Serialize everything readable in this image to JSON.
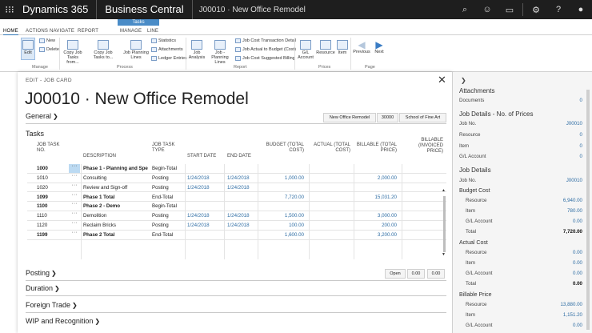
{
  "topbar": {
    "product": "Dynamics 365",
    "app": "Business Central",
    "breadcrumb": "J00010 · New Office Remodel"
  },
  "ribbon": {
    "context_group": "Tasks",
    "tabs": [
      "HOME",
      "ACTIONS",
      "NAVIGATE",
      "REPORT",
      "MANAGE",
      "LINE"
    ],
    "manage": {
      "edit": "Edit",
      "new": "New",
      "delete": "Delete",
      "label": "Manage"
    },
    "process": {
      "copy_from": "Copy Job Tasks from...",
      "copy_to": "Copy Job Tasks to...",
      "planning_lines": "Job Planning Lines",
      "statistics": "Statistics",
      "attachments": "Attachments",
      "ledger_entries": "Ledger Entries",
      "label": "Process"
    },
    "report": {
      "job_analysis": "Job Analysis",
      "job_planning_lines": "Job - Planning Lines",
      "cost_detail": "Job Cost Transaction Detail",
      "actual_to_budget": "Job Actual to Budget (Cost)",
      "suggested_billing": "Job Cost Suggested Billing",
      "label": "Report"
    },
    "prices": {
      "gl_account": "G/L Account",
      "resource": "Resource",
      "item": "Item",
      "label": "Prices"
    },
    "page": {
      "previous": "Previous",
      "next": "Next",
      "label": "Page"
    }
  },
  "card": {
    "header": "EDIT - JOB CARD",
    "title": "J00010 · New Office Remodel",
    "general": "General",
    "general_pills": [
      "New Office Remodel",
      "30000",
      "School of Fine Art"
    ],
    "tasks_title": "Tasks",
    "columns": {
      "no": "JOB TASK NO.",
      "desc": "DESCRIPTION",
      "type": "JOB TASK TYPE",
      "start": "START DATE",
      "end": "END DATE",
      "budget": "BUDGET (TOTAL COST)",
      "actual": "ACTUAL (TOTAL COST)",
      "billable": "BILLABLE (TOTAL PRICE)",
      "invoiced": "BILLABLE (INVOICED PRICE)"
    },
    "rows": [
      {
        "no": "1000",
        "desc": "Phase 1 - Planning and Spe",
        "type": "Begin-Total",
        "start": "",
        "end": "",
        "budget": "",
        "actual": "",
        "billable": "",
        "bold": true
      },
      {
        "no": "1010",
        "desc": "Consulting",
        "type": "Posting",
        "start": "1/24/2018",
        "end": "1/24/2018",
        "budget": "1,000.00",
        "actual": "",
        "billable": "2,000.00",
        "bold": false
      },
      {
        "no": "1020",
        "desc": "Review and Sign-off",
        "type": "Posting",
        "start": "1/24/2018",
        "end": "1/24/2018",
        "budget": "",
        "actual": "",
        "billable": "",
        "bold": false
      },
      {
        "no": "1099",
        "desc": "Phase 1 Total",
        "type": "End-Total",
        "start": "",
        "end": "",
        "budget": "7,720.00",
        "actual": "",
        "billable": "15,031.20",
        "bold": true
      },
      {
        "no": "1100",
        "desc": "Phase 2 - Demo",
        "type": "Begin-Total",
        "start": "",
        "end": "",
        "budget": "",
        "actual": "",
        "billable": "",
        "bold": true
      },
      {
        "no": "1110",
        "desc": "Demolition",
        "type": "Posting",
        "start": "1/24/2018",
        "end": "1/24/2018",
        "budget": "1,500.00",
        "actual": "",
        "billable": "3,000.00",
        "bold": false
      },
      {
        "no": "1120",
        "desc": "Reclaim Bricks",
        "type": "Posting",
        "start": "1/24/2018",
        "end": "1/24/2018",
        "budget": "100.00",
        "actual": "",
        "billable": "200.00",
        "bold": false
      },
      {
        "no": "1199",
        "desc": "Phase 2 Total",
        "type": "End-Total",
        "start": "",
        "end": "",
        "budget": "1,600.00",
        "actual": "",
        "billable": "3,200.00",
        "bold": true
      }
    ],
    "posting": "Posting",
    "posting_pills": [
      "Open",
      "0.00",
      "0.00"
    ],
    "duration": "Duration",
    "foreign_trade": "Foreign Trade",
    "wip": "WIP and Recognition"
  },
  "factbox": {
    "attachments": {
      "title": "Attachments",
      "documents_label": "Documents",
      "documents": "0"
    },
    "prices": {
      "title": "Job Details - No. of Prices",
      "job_no_label": "Job No.",
      "job_no": "J00010",
      "resource_label": "Resource",
      "resource": "0",
      "item_label": "Item",
      "item": "0",
      "gl_label": "G/L Account",
      "gl": "0"
    },
    "details": {
      "title": "Job Details",
      "job_no_label": "Job No.",
      "job_no": "J00010",
      "budget_cost": "Budget Cost",
      "b_resource_label": "Resource",
      "b_resource": "6,940.00",
      "b_item_label": "Item",
      "b_item": "780.00",
      "b_gl_label": "G/L Account",
      "b_gl": "0.00",
      "b_total_label": "Total",
      "b_total": "7,720.00",
      "actual_cost": "Actual Cost",
      "a_resource_label": "Resource",
      "a_resource": "0.00",
      "a_item_label": "Item",
      "a_item": "0.00",
      "a_gl_label": "G/L Account",
      "a_gl": "0.00",
      "a_total_label": "Total",
      "a_total": "0.00",
      "billable_price": "Billable Price",
      "p_resource_label": "Resource",
      "p_resource": "13,880.00",
      "p_item_label": "Item",
      "p_item": "1,151.20",
      "p_gl_label": "G/L Account",
      "p_gl": "0.00"
    }
  }
}
